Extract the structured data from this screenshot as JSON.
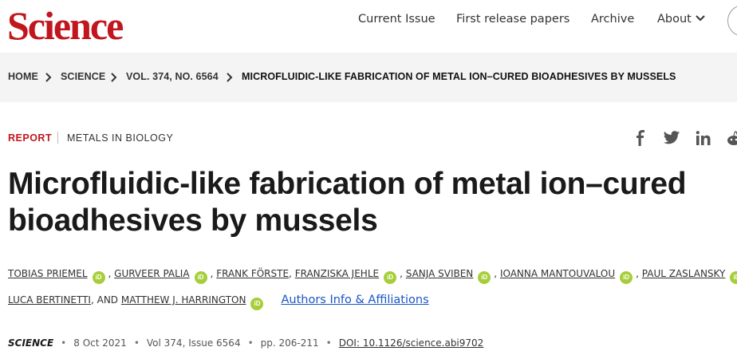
{
  "header": {
    "logo": "Science",
    "nav": [
      "Current Issue",
      "First release papers",
      "Archive",
      "About"
    ]
  },
  "breadcrumb": [
    "HOME",
    "SCIENCE",
    "VOL. 374, NO. 6564",
    "MICROFLUIDIC-LIKE FABRICATION OF METAL ION–CURED BIOADHESIVES BY MUSSELS"
  ],
  "article": {
    "type": "REPORT",
    "subject": "METALS IN BIOLOGY",
    "title": "Microfluidic-like fabrication of metal ion–cured bioadhesives by mussels",
    "authors": [
      "TOBIAS PRIEMEL",
      "GURVEER PALIA",
      "FRANK FÖRSTE",
      "FRANZISKA JEHLE",
      "SANJA SVIBEN",
      "IOANNA MANTOUVALOU",
      "PAUL ZASLANSKY",
      "LUCA BERTINETTI",
      "MATTHEW J. HARRINGTON"
    ],
    "author_and": "AND",
    "orcid_label": "iD",
    "affiliations_link": "Authors Info & Affiliations",
    "citation": {
      "journal": "SCIENCE",
      "date": "8 Oct 2021",
      "volume": "Vol 374, Issue 6564",
      "pages": "pp. 206-211",
      "doi": "DOI: 10.1126/science.abi9702"
    }
  },
  "share": [
    "facebook-icon",
    "twitter-icon",
    "linkedin-icon",
    "reddit-icon"
  ],
  "colors": {
    "brand": "#c1161d",
    "orcid": "#a6ce39",
    "link": "#1a56c4",
    "band": "#f4f4f4"
  }
}
